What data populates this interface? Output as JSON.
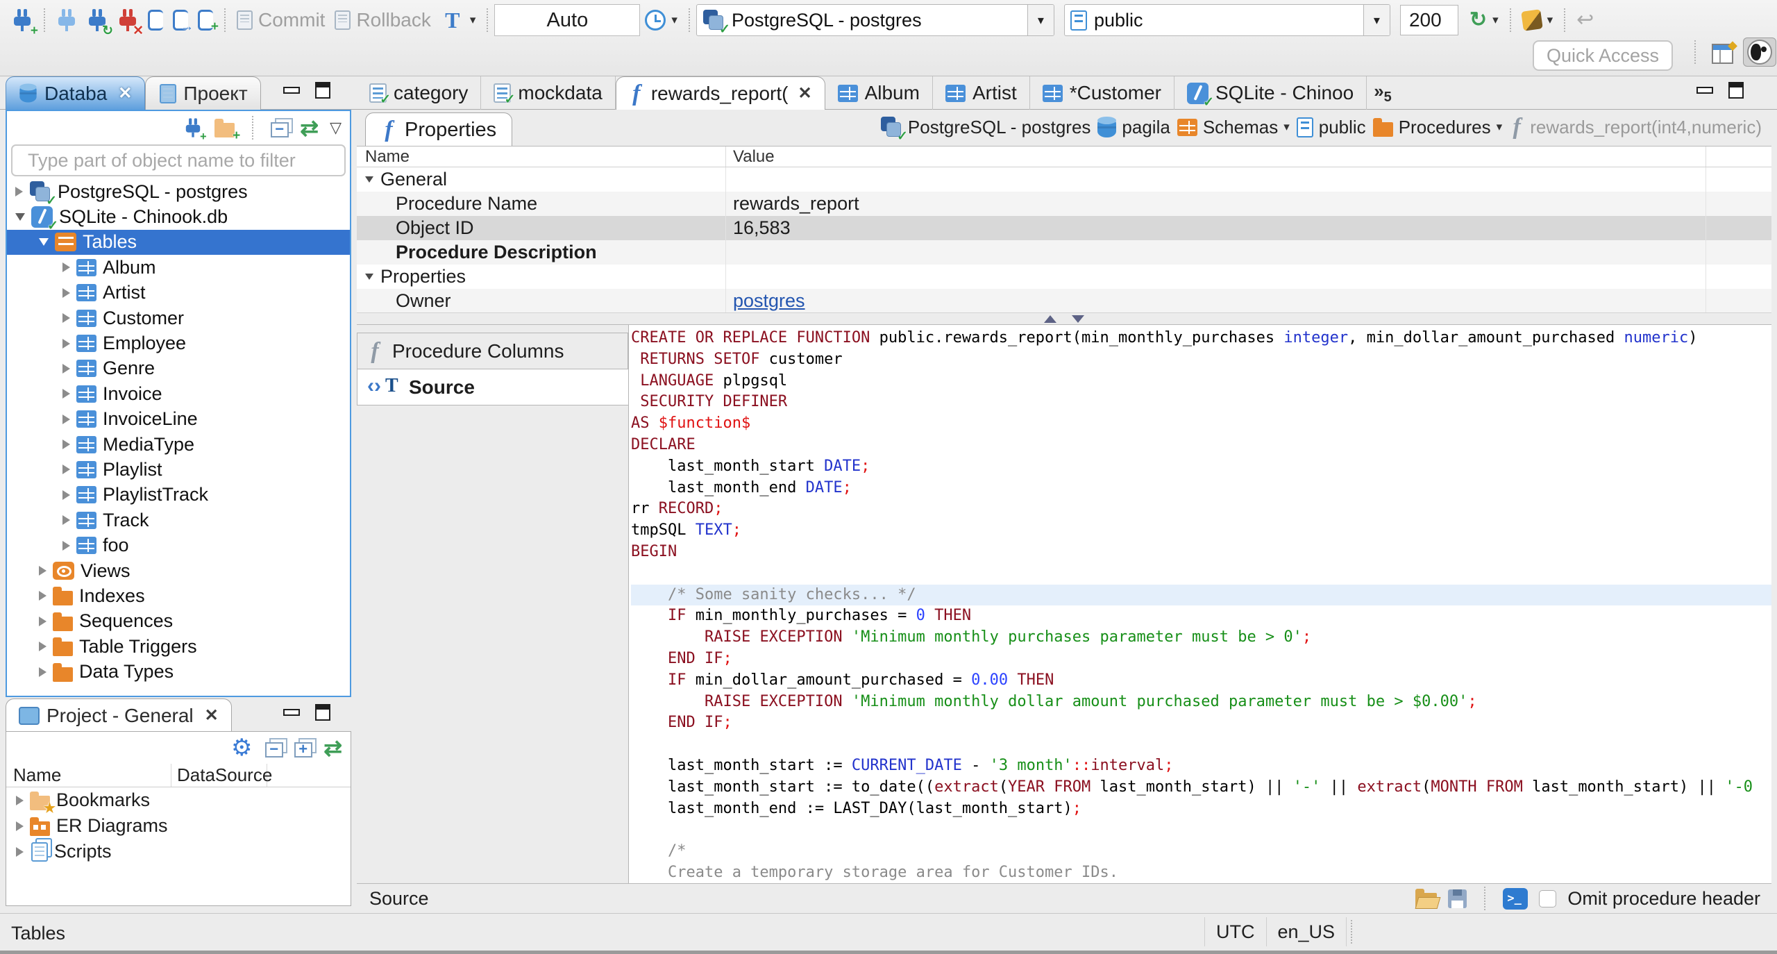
{
  "icons": {
    "close": "✕",
    "dropdown": "▾",
    "sync": "↻",
    "undo": "↩",
    "gear": "⚙",
    "link": "⇄",
    "view_menu": "▽",
    "overflow": "»",
    "exec_arrow": "→",
    "plus": "+",
    "check": "✓",
    "star": "★",
    "diamond": "◆"
  },
  "toolbar": {
    "commit_label": "Commit",
    "rollback_label": "Rollback",
    "txn_mode": "Auto",
    "connection": "PostgreSQL - postgres",
    "schema": "public",
    "fetch_size": "200",
    "quick_access_placeholder": "Quick Access"
  },
  "left": {
    "tabs": [
      {
        "label": "Databa"
      },
      {
        "label": "Проект"
      }
    ],
    "filter_placeholder": "Type part of object name to filter",
    "tree": [
      {
        "label": "PostgreSQL - postgres",
        "icon": "postgres-connection",
        "level": 0,
        "expander": "collapsed"
      },
      {
        "label": "SQLite - Chinook.db",
        "icon": "sqlite-connection",
        "level": 0,
        "expander": "expanded"
      },
      {
        "label": "Tables",
        "icon": "tables-folder",
        "level": 1,
        "expander": "expanded",
        "selected": true
      },
      {
        "label": "Album",
        "icon": "table",
        "level": 2,
        "expander": "collapsed"
      },
      {
        "label": "Artist",
        "icon": "table",
        "level": 2,
        "expander": "collapsed"
      },
      {
        "label": "Customer",
        "icon": "table",
        "level": 2,
        "expander": "collapsed"
      },
      {
        "label": "Employee",
        "icon": "table",
        "level": 2,
        "expander": "collapsed"
      },
      {
        "label": "Genre",
        "icon": "table",
        "level": 2,
        "expander": "collapsed"
      },
      {
        "label": "Invoice",
        "icon": "table",
        "level": 2,
        "expander": "collapsed"
      },
      {
        "label": "InvoiceLine",
        "icon": "table",
        "level": 2,
        "expander": "collapsed"
      },
      {
        "label": "MediaType",
        "icon": "table",
        "level": 2,
        "expander": "collapsed"
      },
      {
        "label": "Playlist",
        "icon": "table",
        "level": 2,
        "expander": "collapsed"
      },
      {
        "label": "PlaylistTrack",
        "icon": "table",
        "level": 2,
        "expander": "collapsed"
      },
      {
        "label": "Track",
        "icon": "table",
        "level": 2,
        "expander": "collapsed"
      },
      {
        "label": "foo",
        "icon": "table",
        "level": 2,
        "expander": "collapsed"
      },
      {
        "label": "Views",
        "icon": "views",
        "level": 1,
        "expander": "collapsed"
      },
      {
        "label": "Indexes",
        "icon": "folder",
        "level": 1,
        "expander": "collapsed"
      },
      {
        "label": "Sequences",
        "icon": "folder",
        "level": 1,
        "expander": "collapsed"
      },
      {
        "label": "Table Triggers",
        "icon": "folder",
        "level": 1,
        "expander": "collapsed"
      },
      {
        "label": "Data Types",
        "icon": "folder",
        "level": 1,
        "expander": "collapsed"
      }
    ]
  },
  "project": {
    "tab_label": "Project - General",
    "columns": [
      "Name",
      "DataSource"
    ],
    "items": [
      {
        "label": "Bookmarks",
        "icon": "bookmarks-folder"
      },
      {
        "label": "ER Diagrams",
        "icon": "er-folder"
      },
      {
        "label": "Scripts",
        "icon": "scripts"
      }
    ]
  },
  "editor": {
    "tabs": [
      {
        "label": "category",
        "icon": "sql-script"
      },
      {
        "label": "mockdata",
        "icon": "sql-script"
      },
      {
        "label": "rewards_report(",
        "icon": "function",
        "active": true,
        "closable": true
      },
      {
        "label": "Album",
        "icon": "table"
      },
      {
        "label": "Artist",
        "icon": "table"
      },
      {
        "label": "*Customer",
        "icon": "table"
      },
      {
        "label": "SQLite - Chinoo",
        "icon": "sqlite-connection"
      }
    ],
    "overflow_count": "5",
    "subtab_label": "Properties",
    "breadcrumb": [
      {
        "label": "PostgreSQL - postgres",
        "icon": "postgres-connection"
      },
      {
        "label": "pagila",
        "icon": "database"
      },
      {
        "label": "Schemas",
        "icon": "schemas-grid",
        "dropdown": true
      },
      {
        "label": "public",
        "icon": "schema-page"
      },
      {
        "label": "Procedures",
        "icon": "folder",
        "dropdown": true
      },
      {
        "label": "rewards_report(int4,numeric)",
        "icon": "function-gray",
        "muted": true
      }
    ],
    "grid": {
      "columns": [
        "Name",
        "Value"
      ],
      "rows": [
        {
          "name": "General",
          "value": "",
          "group": true
        },
        {
          "name": "Procedure Name",
          "value": "rewards_report",
          "indent": 1
        },
        {
          "name": "Object ID",
          "value": "16,583",
          "indent": 1,
          "selected": true
        },
        {
          "name": "Procedure Description",
          "value": "",
          "indent": 1,
          "bold": true
        },
        {
          "name": "Properties",
          "value": "",
          "group": true
        },
        {
          "name": "Owner",
          "value": "postgres",
          "indent": 1,
          "link": true
        }
      ]
    },
    "side_tabs": [
      {
        "label": "Procedure Columns",
        "icon": "function-gray"
      },
      {
        "label": "Source",
        "icon": "source",
        "active": true
      }
    ],
    "bottom": {
      "status": "Source",
      "omit_label": "Omit procedure header"
    },
    "code_lines": [
      {
        "toks": [
          [
            "k",
            "CREATE OR REPLACE FUNCTION"
          ],
          [
            "p",
            " public.rewards_report(min_monthly_purchases "
          ],
          [
            "t",
            "integer"
          ],
          [
            "p",
            ", min_dollar_amount_purchased "
          ],
          [
            "t",
            "numeric"
          ],
          [
            "p",
            ")"
          ]
        ]
      },
      {
        "toks": [
          [
            "p",
            " "
          ],
          [
            "k",
            "RETURNS SETOF"
          ],
          [
            "p",
            " customer"
          ]
        ]
      },
      {
        "toks": [
          [
            "p",
            " "
          ],
          [
            "k",
            "LANGUAGE"
          ],
          [
            "p",
            " plpgsql"
          ]
        ]
      },
      {
        "toks": [
          [
            "p",
            " "
          ],
          [
            "k",
            "SECURITY DEFINER"
          ]
        ]
      },
      {
        "toks": [
          [
            "k",
            "AS"
          ],
          [
            "r",
            " $function$"
          ]
        ]
      },
      {
        "toks": [
          [
            "k",
            "DECLARE"
          ]
        ]
      },
      {
        "toks": [
          [
            "p",
            "    last_month_start "
          ],
          [
            "t",
            "DATE"
          ],
          [
            "r",
            ";"
          ]
        ]
      },
      {
        "toks": [
          [
            "p",
            "    last_month_end "
          ],
          [
            "t",
            "DATE"
          ],
          [
            "r",
            ";"
          ]
        ]
      },
      {
        "toks": [
          [
            "p",
            "rr "
          ],
          [
            "k",
            "RECORD"
          ],
          [
            "r",
            ";"
          ]
        ]
      },
      {
        "toks": [
          [
            "p",
            "tmpSQL "
          ],
          [
            "t",
            "TEXT"
          ],
          [
            "r",
            ";"
          ]
        ]
      },
      {
        "toks": [
          [
            "k",
            "BEGIN"
          ]
        ]
      },
      {
        "toks": []
      },
      {
        "hl": true,
        "toks": [
          [
            "c",
            "    /* Some sanity checks... */"
          ]
        ]
      },
      {
        "toks": [
          [
            "p",
            "    "
          ],
          [
            "k",
            "IF"
          ],
          [
            "p",
            " min_monthly_purchases = "
          ],
          [
            "n",
            "0"
          ],
          [
            "p",
            " "
          ],
          [
            "k",
            "THEN"
          ]
        ]
      },
      {
        "toks": [
          [
            "p",
            "        "
          ],
          [
            "k",
            "RAISE EXCEPTION"
          ],
          [
            "s",
            " 'Minimum monthly purchases parameter must be > 0'"
          ],
          [
            "r",
            ";"
          ]
        ]
      },
      {
        "toks": [
          [
            "p",
            "    "
          ],
          [
            "k",
            "END IF"
          ],
          [
            "r",
            ";"
          ]
        ]
      },
      {
        "toks": [
          [
            "p",
            "    "
          ],
          [
            "k",
            "IF"
          ],
          [
            "p",
            " min_dollar_amount_purchased = "
          ],
          [
            "n",
            "0.00"
          ],
          [
            "p",
            " "
          ],
          [
            "k",
            "THEN"
          ]
        ]
      },
      {
        "toks": [
          [
            "p",
            "        "
          ],
          [
            "k",
            "RAISE EXCEPTION"
          ],
          [
            "s",
            " 'Minimum monthly dollar amount purchased parameter must be > $0.00'"
          ],
          [
            "r",
            ";"
          ]
        ]
      },
      {
        "toks": [
          [
            "p",
            "    "
          ],
          [
            "k",
            "END IF"
          ],
          [
            "r",
            ";"
          ]
        ]
      },
      {
        "toks": []
      },
      {
        "toks": [
          [
            "p",
            "    last_month_start := "
          ],
          [
            "t",
            "CURRENT_DATE"
          ],
          [
            "p",
            " - "
          ],
          [
            "s",
            "'3 month'"
          ],
          [
            "r",
            "::"
          ],
          [
            "k",
            "interval"
          ],
          [
            "r",
            ";"
          ]
        ]
      },
      {
        "toks": [
          [
            "p",
            "    last_month_start := to_date(("
          ],
          [
            "k",
            "extract"
          ],
          [
            "p",
            "("
          ],
          [
            "k",
            "YEAR FROM"
          ],
          [
            "p",
            " last_month_start) || "
          ],
          [
            "s",
            "'-'"
          ],
          [
            "p",
            " || "
          ],
          [
            "k",
            "extract"
          ],
          [
            "p",
            "("
          ],
          [
            "k",
            "MONTH FROM"
          ],
          [
            "p",
            " last_month_start) || "
          ],
          [
            "s",
            "'-0"
          ]
        ]
      },
      {
        "toks": [
          [
            "p",
            "    last_month_end := LAST_DAY(last_month_start)"
          ],
          [
            "r",
            ";"
          ]
        ]
      },
      {
        "toks": []
      },
      {
        "toks": [
          [
            "c",
            "    /*"
          ]
        ]
      },
      {
        "toks": [
          [
            "c",
            "    Create a temporary storage area for Customer IDs."
          ]
        ]
      },
      {
        "toks": [
          [
            "c",
            "    */"
          ]
        ]
      }
    ]
  },
  "status": {
    "left": "Tables",
    "timezone": "UTC",
    "locale": "en_US"
  }
}
